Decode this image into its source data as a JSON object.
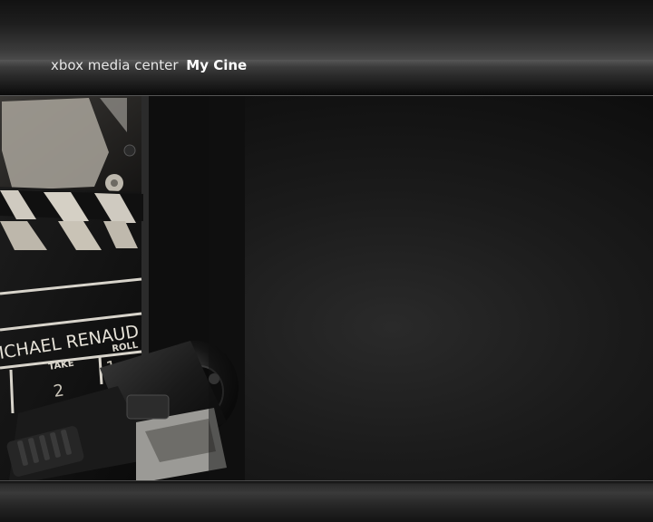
{
  "header": {
    "brand": "xbox media center",
    "section": "My Cine"
  },
  "photo": {
    "slate_name": "ICHAEL RENAUD",
    "take_label": "TAKE",
    "roll_label": "ROLL",
    "take_value": "2",
    "roll_value": "1"
  }
}
